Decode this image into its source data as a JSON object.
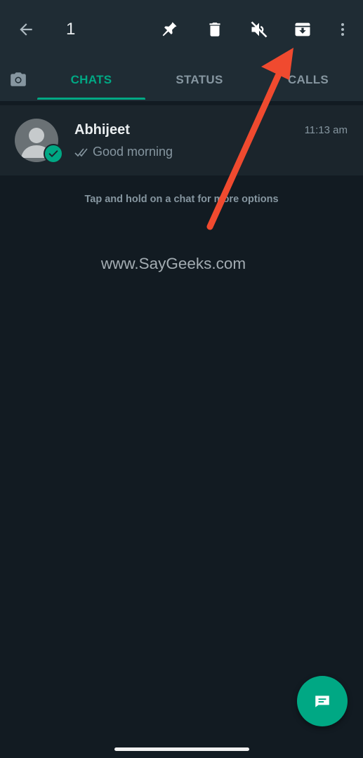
{
  "toolbar": {
    "selected_count": "1",
    "actions": [
      "back-icon",
      "pin-icon",
      "delete-icon",
      "mute-icon",
      "archive-icon",
      "more-options-icon"
    ]
  },
  "tabs": {
    "camera_icon": "camera-icon",
    "items": [
      {
        "label": "CHATS",
        "active": true
      },
      {
        "label": "STATUS",
        "active": false
      },
      {
        "label": "CALLS",
        "active": false
      }
    ]
  },
  "chat": {
    "name": "Abhijeet",
    "time": "11:13 am",
    "preview": "Good morning",
    "selected": true
  },
  "hint": "Tap and hold on a chat for more options",
  "watermark": "www.SayGeeks.com",
  "colors": {
    "accent": "#00a884",
    "bar": "#1f2c34",
    "background": "#121b22",
    "annotation_arrow": "#f04a2f"
  }
}
